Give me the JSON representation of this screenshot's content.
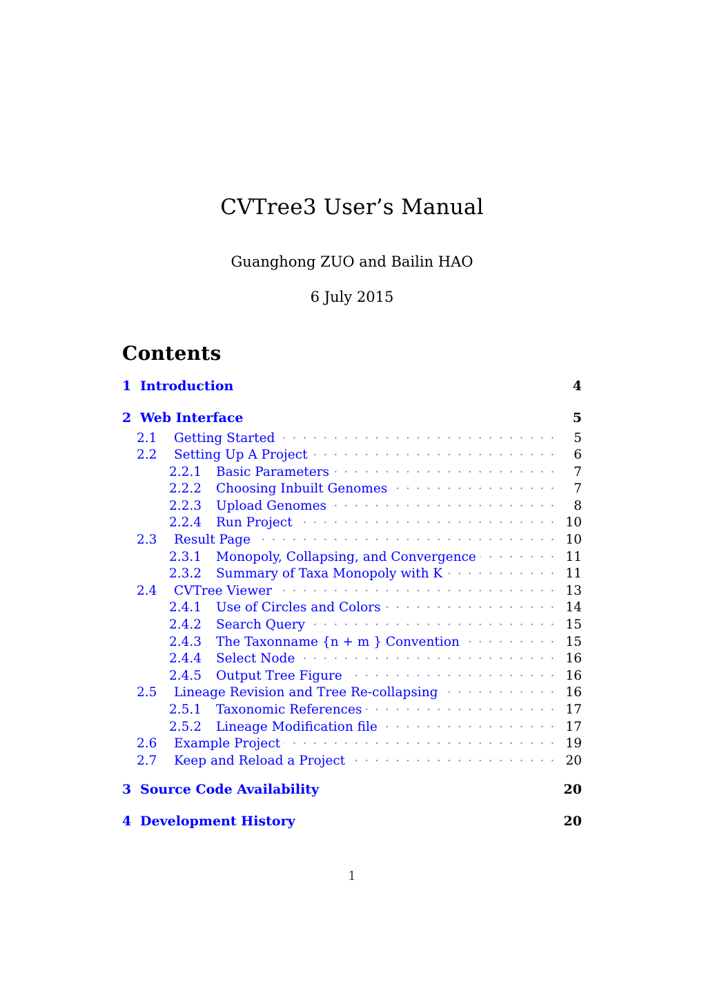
{
  "document": {
    "title": "CVTree3 User’s Manual",
    "authors": "Guanghong ZUO and Bailin HAO",
    "date": "6 July 2015",
    "folio": "1",
    "accent_color": "#0000ff",
    "text_color": "#000000",
    "leader_color": "#8a8ad0"
  },
  "contents": {
    "heading": "Contents",
    "entries": [
      {
        "level": 1,
        "number": "1",
        "label": "Introduction",
        "page": "4"
      },
      {
        "level": 1,
        "number": "2",
        "label": "Web Interface",
        "page": "5"
      },
      {
        "level": 2,
        "number": "2.1",
        "label": "Getting Started",
        "page": "5"
      },
      {
        "level": 2,
        "number": "2.2",
        "label": "Setting Up A Project",
        "page": "6"
      },
      {
        "level": 3,
        "number": "2.2.1",
        "label": "Basic Parameters",
        "page": "7"
      },
      {
        "level": 3,
        "number": "2.2.2",
        "label": "Choosing Inbuilt Genomes",
        "page": "7"
      },
      {
        "level": 3,
        "number": "2.2.3",
        "label": "Upload Genomes",
        "page": "8"
      },
      {
        "level": 3,
        "number": "2.2.4",
        "label": "Run Project",
        "page": "10"
      },
      {
        "level": 2,
        "number": "2.3",
        "label": "Result Page",
        "page": "10"
      },
      {
        "level": 3,
        "number": "2.3.1",
        "label": "Monopoly, Collapsing, and Convergence",
        "page": "11"
      },
      {
        "level": 3,
        "number": "2.3.2",
        "label": "Summary of Taxa Monopoly with K",
        "page": "11"
      },
      {
        "level": 2,
        "number": "2.4",
        "label": "CVTree Viewer",
        "page": "13"
      },
      {
        "level": 3,
        "number": "2.4.1",
        "label": "Use of Circles and Colors",
        "page": "14"
      },
      {
        "level": 3,
        "number": "2.4.2",
        "label": "Search Query",
        "page": "15"
      },
      {
        "level": 3,
        "number": "2.4.3",
        "label": "The Taxonname {n + m } Convention",
        "page": "15"
      },
      {
        "level": 3,
        "number": "2.4.4",
        "label": "Select Node",
        "page": "16"
      },
      {
        "level": 3,
        "number": "2.4.5",
        "label": "Output Tree Figure",
        "page": "16"
      },
      {
        "level": 2,
        "number": "2.5",
        "label": "Lineage Revision and Tree Re-collapsing",
        "page": "16"
      },
      {
        "level": 3,
        "number": "2.5.1",
        "label": "Taxonomic References",
        "page": "17"
      },
      {
        "level": 3,
        "number": "2.5.2",
        "label": "Lineage Modification file",
        "page": "17"
      },
      {
        "level": 2,
        "number": "2.6",
        "label": "Example Project",
        "page": "19"
      },
      {
        "level": 2,
        "number": "2.7",
        "label": "Keep and Reload a Project",
        "page": "20"
      },
      {
        "level": 1,
        "number": "3",
        "label": "Source Code Availability",
        "page": "20"
      },
      {
        "level": 1,
        "number": "4",
        "label": "Development History",
        "page": "20"
      }
    ]
  }
}
